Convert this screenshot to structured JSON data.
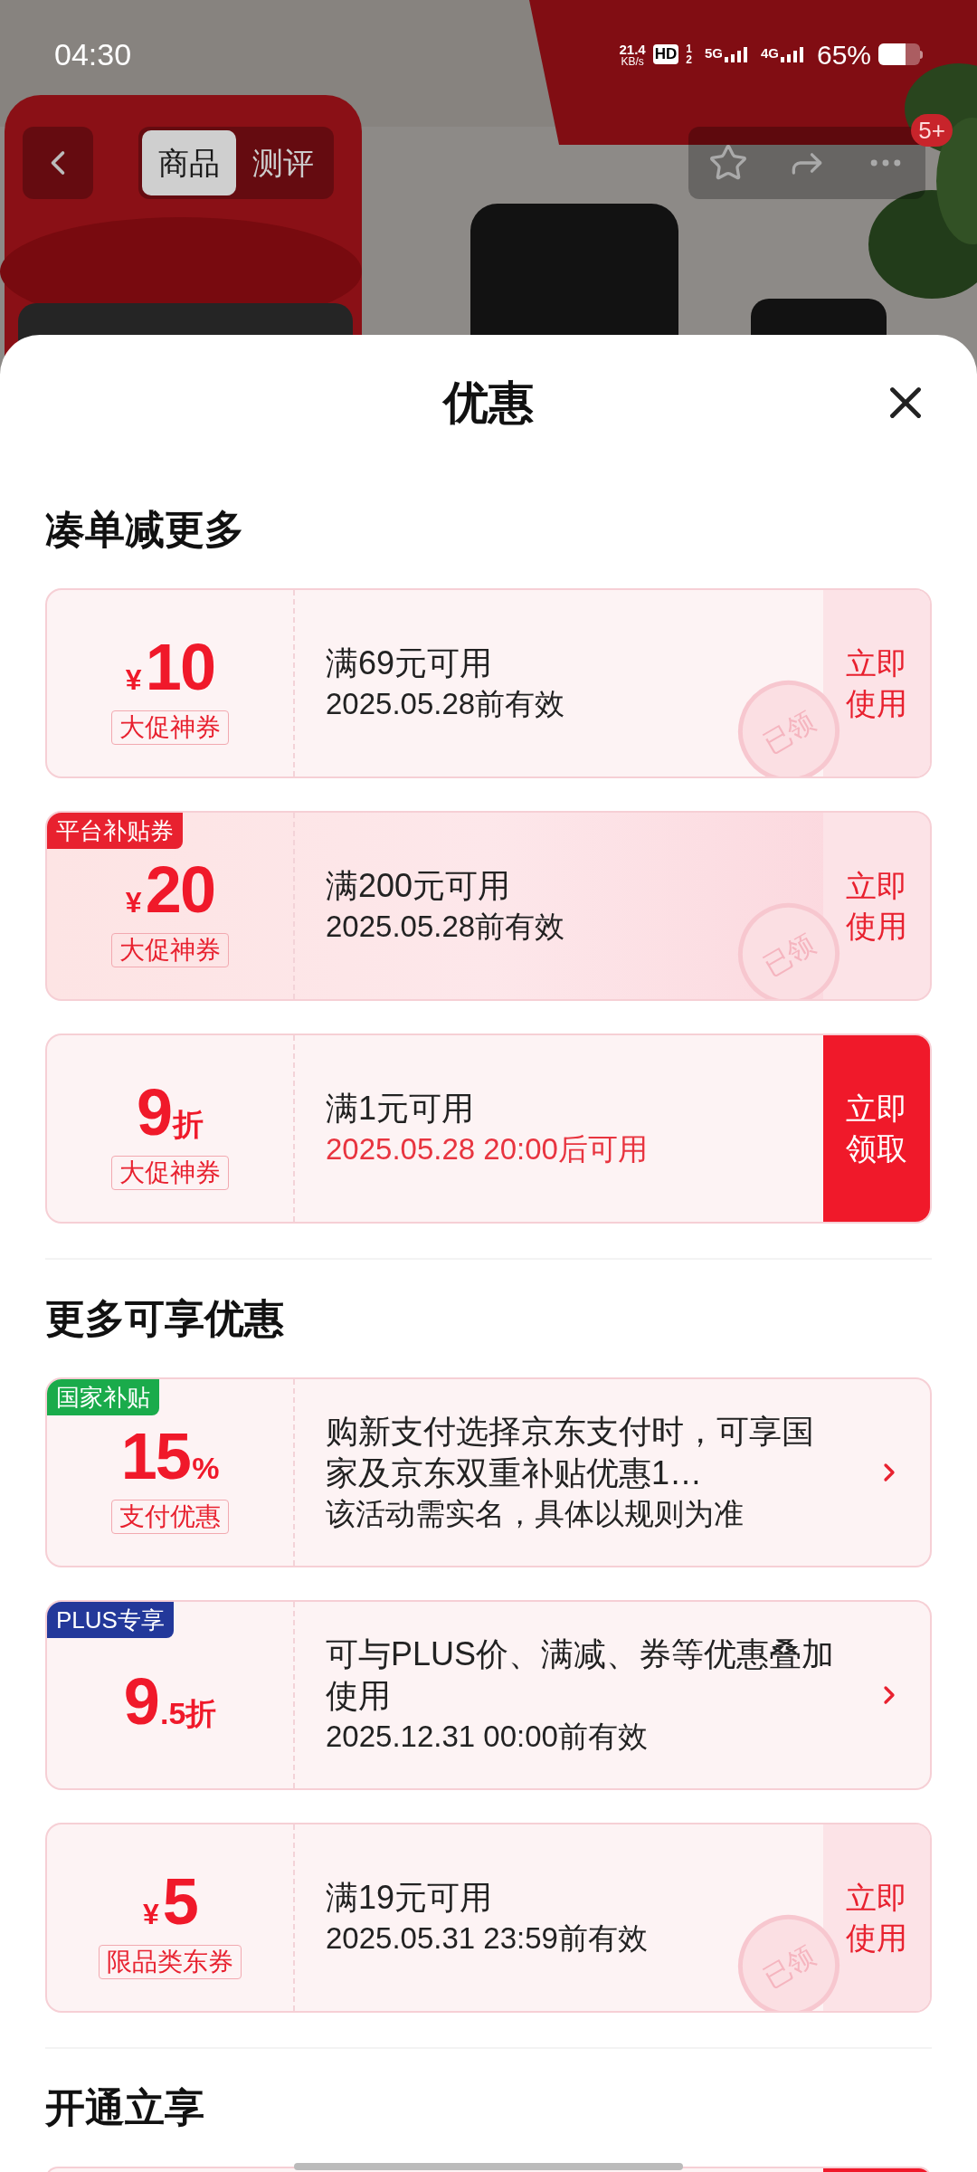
{
  "status_bar": {
    "time": "04:30",
    "speed": "21.4",
    "speed_unit": "KB/s",
    "hd": "HD",
    "sims": [
      "1",
      "2"
    ],
    "networks": [
      "5G",
      "4G"
    ],
    "battery": "65%"
  },
  "nav": {
    "tabs": [
      {
        "label": "商品",
        "selected": true
      },
      {
        "label": "测评",
        "selected": false
      }
    ],
    "badge": "5+"
  },
  "sheet": {
    "title": "优惠",
    "sections": [
      {
        "heading": "凑单减更多",
        "items": [
          {
            "kind": "coupon",
            "featured": false,
            "currency": "¥",
            "value": "10",
            "tag": "大促神券",
            "line1": "满69元可用",
            "line2": "2025.05.28前有效",
            "line2_alert": false,
            "action": "立即使用",
            "primary": false,
            "stamp": "已领"
          },
          {
            "kind": "coupon",
            "featured": true,
            "ribbon": {
              "label": "平台补贴券",
              "color": "#e8212f"
            },
            "currency": "¥",
            "value": "20",
            "tag": "大促神券",
            "line1": "满200元可用",
            "line2": "2025.05.28前有效",
            "line2_alert": false,
            "action": "立即使用",
            "primary": false,
            "stamp": "已领"
          },
          {
            "kind": "coupon",
            "featured": false,
            "value": "9",
            "unit": "折",
            "tag": "大促神券",
            "line1": "满1元可用",
            "line2": "2025.05.28 20:00后可用",
            "line2_alert": true,
            "action": "立即领取",
            "primary": true
          }
        ]
      },
      {
        "heading": "更多可享优惠",
        "items": [
          {
            "kind": "offer",
            "featured": false,
            "ribbon": {
              "label": "国家补贴",
              "color": "#1aab4b"
            },
            "value": "15",
            "unit": "%",
            "tag": "支付优惠",
            "line1": "购新支付选择京东支付时，可享国家及京东双重补贴优惠1…",
            "line2": "该活动需实名，具体以规则为准",
            "line2_alert": false
          },
          {
            "kind": "offer",
            "featured": false,
            "ribbon": {
              "label": "PLUS专享",
              "color": "#23389a"
            },
            "value": "9",
            "unit": ".5折",
            "line1": "可与PLUS价、满减、券等优惠叠加使用",
            "line2": "2025.12.31 00:00前有效",
            "line2_alert": false
          },
          {
            "kind": "coupon",
            "featured": false,
            "currency": "¥",
            "value": "5",
            "tag": "限品类东券",
            "line1": "满19元可用",
            "line2": "2025.05.31 23:59前有效",
            "line2_alert": false,
            "action": "立即使用",
            "primary": false,
            "stamp": "已领"
          }
        ]
      },
      {
        "heading": "开通立享",
        "items": [
          {
            "kind": "peek"
          }
        ]
      }
    ]
  }
}
